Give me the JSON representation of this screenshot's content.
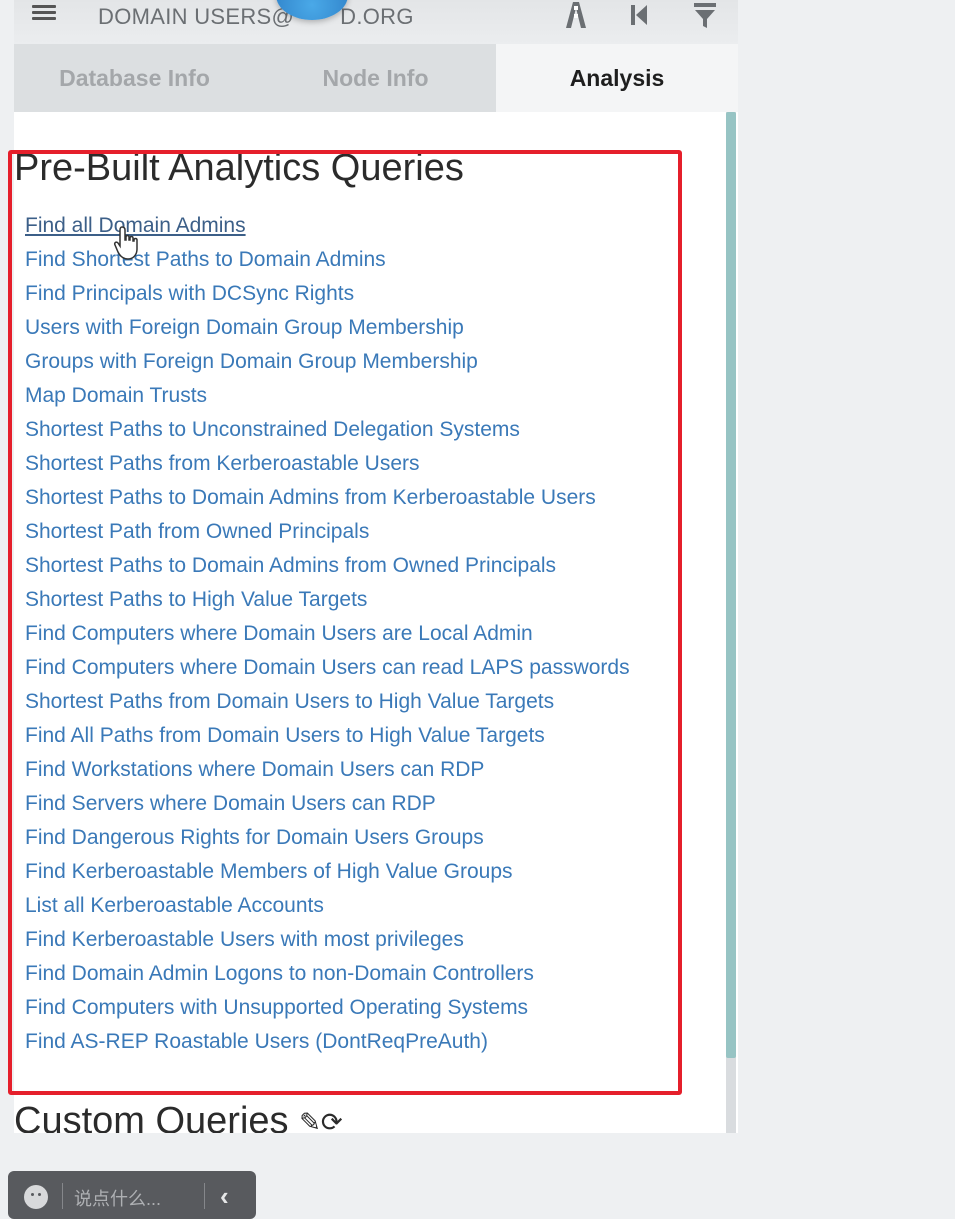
{
  "header": {
    "search_text": "DOMAIN USERS@",
    "search_text_suffix": "D.ORG",
    "menu_icon": "hamburger-icon",
    "icons": [
      "pathfinding-icon",
      "back-icon",
      "filter-icon"
    ]
  },
  "tabs": [
    {
      "label": "Database Info",
      "active": false
    },
    {
      "label": "Node Info",
      "active": false
    },
    {
      "label": "Analysis",
      "active": true
    }
  ],
  "analysis": {
    "prebuilt_title": "Pre-Built Analytics Queries",
    "queries": [
      "Find all Domain Admins",
      "Find Shortest Paths to Domain Admins",
      "Find Principals with DCSync Rights",
      "Users with Foreign Domain Group Membership",
      "Groups with Foreign Domain Group Membership",
      "Map Domain Trusts",
      "Shortest Paths to Unconstrained Delegation Systems",
      "Shortest Paths from Kerberoastable Users",
      "Shortest Paths to Domain Admins from Kerberoastable Users",
      "Shortest Path from Owned Principals",
      "Shortest Paths to Domain Admins from Owned Principals",
      "Shortest Paths to High Value Targets",
      "Find Computers where Domain Users are Local Admin",
      "Find Computers where Domain Users can read LAPS passwords",
      "Shortest Paths from Domain Users to High Value Targets",
      "Find All Paths from Domain Users to High Value Targets",
      "Find Workstations where Domain Users can RDP",
      "Find Servers where Domain Users can RDP",
      "Find Dangerous Rights for Domain Users Groups",
      "Find Kerberoastable Members of High Value Groups",
      "List all Kerberoastable Accounts",
      "Find Kerberoastable Users with most privileges",
      "Find Domain Admin Logons to non-Domain Controllers",
      "Find Computers with Unsupported Operating Systems",
      "Find AS-REP Roastable Users (DontReqPreAuth)"
    ],
    "hovered_index": 0,
    "custom_title": "Custom Queries"
  },
  "chat": {
    "placeholder": "说点什么..."
  },
  "colors": {
    "link": "#3a79b8",
    "highlight_border": "#e51f2b",
    "scrollbar": "#97c4c4"
  }
}
